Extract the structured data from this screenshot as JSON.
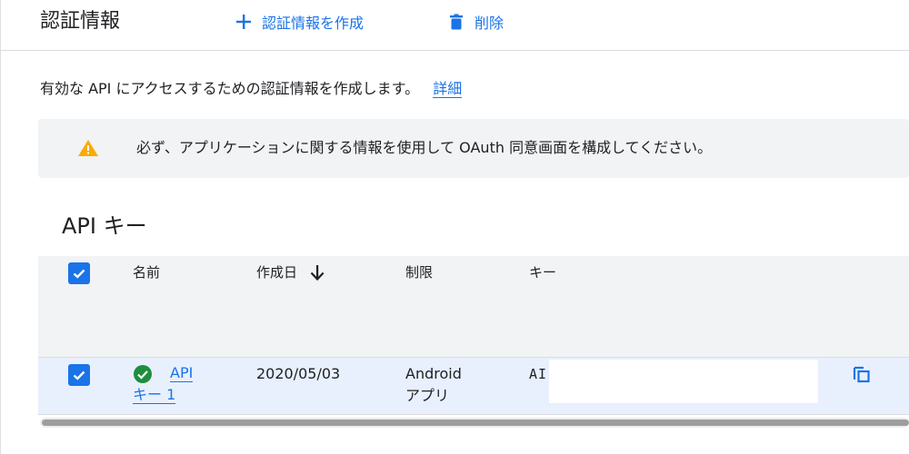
{
  "header": {
    "title": "認証情報",
    "create_label": "認証情報を作成",
    "delete_label": "削除"
  },
  "intro": {
    "text": "有効な API にアクセスするための認証情報を作成します。",
    "link": "詳細"
  },
  "warning": {
    "text": "必ず、アプリケーションに関する情報を使用して OAuth 同意画面を構成してください。"
  },
  "api_keys": {
    "section_title": "API キー",
    "columns": {
      "name": "名前",
      "created": "作成日",
      "restriction": "制限",
      "key": "キー"
    },
    "rows": [
      {
        "name_line1": "API",
        "name_line2": "キー 1",
        "created": "2020/05/03",
        "restriction_line1": "Android",
        "restriction_line2": "アプリ",
        "key_prefix": "AI"
      }
    ]
  },
  "colors": {
    "accent": "#1a73e8",
    "warning": "#f9ab00",
    "success": "#1e8e3e",
    "selected_row": "#e8f0fe"
  }
}
